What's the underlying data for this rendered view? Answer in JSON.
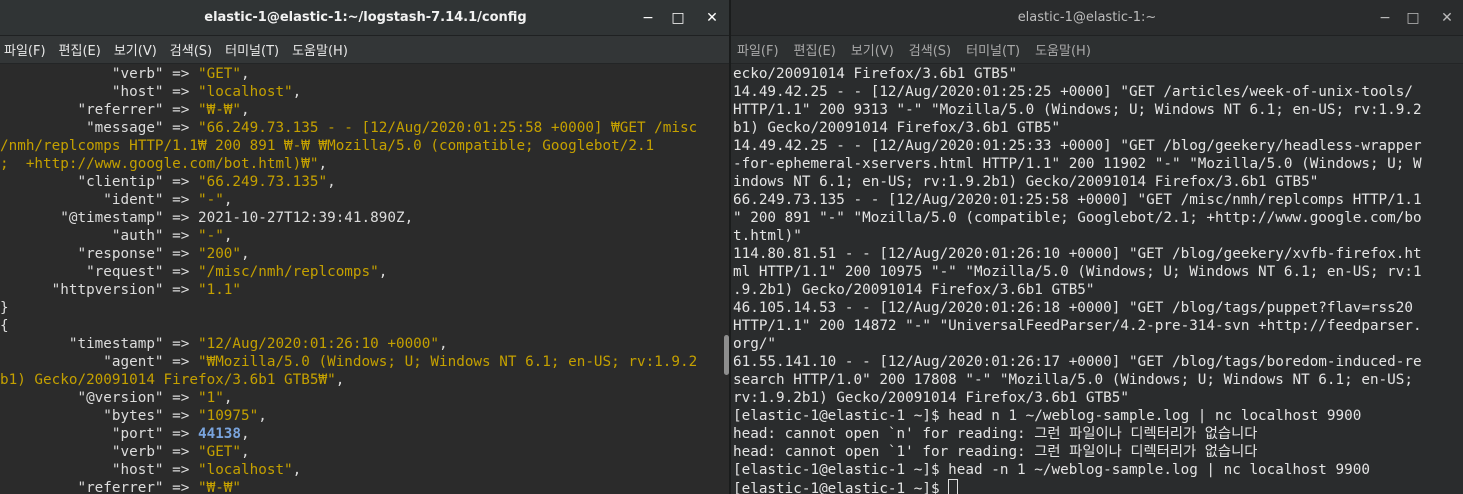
{
  "left_window": {
    "title": "elastic-1@elastic-1:~/logstash-7.14.1/config",
    "minimize": "−",
    "maximize": "□",
    "close": "✕",
    "menu": [
      "파일(F)",
      "편집(E)",
      "보기(V)",
      "검색(S)",
      "터미널(T)",
      "도움말(H)"
    ],
    "lines": [
      {
        "k": "             \"verb\" => ",
        "v": "\"GET\"",
        "t": ","
      },
      {
        "k": "             \"host\" => ",
        "v": "\"localhost\"",
        "t": ","
      },
      {
        "k": "         \"referrer\" => ",
        "v": "\"₩-₩\"",
        "t": ","
      },
      {
        "k": "          \"message\" => ",
        "v": "\"66.249.73.135 - - [12/Aug/2020:01:25:58 +0000] ₩GET /misc",
        "t": ""
      },
      {
        "k": "",
        "v": "/nmh/replcomps HTTP/1.1₩ 200 891 ₩-₩ ₩Mozilla/5.0 (compatible; Googlebot/2.1",
        "t": ""
      },
      {
        "k": "",
        "v": ";  +http://www.google.com/bot.html)₩\"",
        "t": ","
      },
      {
        "k": "         \"clientip\" => ",
        "v": "\"66.249.73.135\"",
        "t": ","
      },
      {
        "k": "            \"ident\" => ",
        "v": "\"-\"",
        "t": ","
      },
      {
        "k": "       \"@timestamp\" => ",
        "v": "",
        "t": "2021-10-27T12:39:41.890Z,"
      },
      {
        "k": "             \"auth\" => ",
        "v": "\"-\"",
        "t": ","
      },
      {
        "k": "         \"response\" => ",
        "v": "\"200\"",
        "t": ","
      },
      {
        "k": "          \"request\" => ",
        "v": "\"/misc/nmh/replcomps\"",
        "t": ","
      },
      {
        "k": "      \"httpversion\" => ",
        "v": "\"1.1\"",
        "t": ""
      },
      {
        "k": "}",
        "v": "",
        "t": ""
      },
      {
        "k": "{",
        "v": "",
        "t": ""
      },
      {
        "k": "        \"timestamp\" => ",
        "v": "\"12/Aug/2020:01:26:10 +0000\"",
        "t": ","
      },
      {
        "k": "            \"agent\" => ",
        "v": "\"₩Mozilla/5.0 (Windows; U; Windows NT 6.1; en-US; rv:1.9.2",
        "t": ""
      },
      {
        "k": "",
        "v": "b1) Gecko/20091014 Firefox/3.6b1 GTB5₩\"",
        "t": ","
      },
      {
        "k": "         \"@version\" => ",
        "v": "\"1\"",
        "t": ","
      },
      {
        "k": "            \"bytes\" => ",
        "v": "\"10975\"",
        "t": ","
      },
      {
        "k": "             \"port\" => ",
        "v": "",
        "t": "",
        "n": "44138",
        "after": ","
      },
      {
        "k": "             \"verb\" => ",
        "v": "\"GET\"",
        "t": ","
      },
      {
        "k": "             \"host\" => ",
        "v": "\"localhost\"",
        "t": ","
      },
      {
        "k": "         \"referrer\" => ",
        "v": "\"₩-₩\"",
        "t": ""
      }
    ]
  },
  "right_window": {
    "title": "elastic-1@elastic-1:~",
    "minimize": "−",
    "maximize": "□",
    "close": "✕",
    "menu": [
      "파일(F)",
      "편집(E)",
      "보기(V)",
      "검색(S)",
      "터미널(T)",
      "도움말(H)"
    ],
    "lines": [
      "ecko/20091014 Firefox/3.6b1 GTB5\"",
      "14.49.42.25 - - [12/Aug/2020:01:25:25 +0000] \"GET /articles/week-of-unix-tools/",
      "HTTP/1.1\" 200 9313 \"-\" \"Mozilla/5.0 (Windows; U; Windows NT 6.1; en-US; rv:1.9.2",
      "b1) Gecko/20091014 Firefox/3.6b1 GTB5\"",
      "14.49.42.25 - - [12/Aug/2020:01:25:33 +0000] \"GET /blog/geekery/headless-wrapper",
      "-for-ephemeral-xservers.html HTTP/1.1\" 200 11902 \"-\" \"Mozilla/5.0 (Windows; U; W",
      "indows NT 6.1; en-US; rv:1.9.2b1) Gecko/20091014 Firefox/3.6b1 GTB5\"",
      "66.249.73.135 - - [12/Aug/2020:01:25:58 +0000] \"GET /misc/nmh/replcomps HTTP/1.1",
      "\" 200 891 \"-\" \"Mozilla/5.0 (compatible; Googlebot/2.1; +http://www.google.com/bo",
      "t.html)\"",
      "114.80.81.51 - - [12/Aug/2020:01:26:10 +0000] \"GET /blog/geekery/xvfb-firefox.ht",
      "ml HTTP/1.1\" 200 10975 \"-\" \"Mozilla/5.0 (Windows; U; Windows NT 6.1; en-US; rv:1",
      ".9.2b1) Gecko/20091014 Firefox/3.6b1 GTB5\"",
      "46.105.14.53 - - [12/Aug/2020:01:26:18 +0000] \"GET /blog/tags/puppet?flav=rss20",
      "HTTP/1.1\" 200 14872 \"-\" \"UniversalFeedParser/4.2-pre-314-svn +http://feedparser.",
      "org/\"",
      "61.55.141.10 - - [12/Aug/2020:01:26:17 +0000] \"GET /blog/tags/boredom-induced-re",
      "search HTTP/1.0\" 200 17808 \"-\" \"Mozilla/5.0 (Windows; U; Windows NT 6.1; en-US;",
      "rv:1.9.2b1) Gecko/20091014 Firefox/3.6b1 GTB5\"",
      "[elastic-1@elastic-1 ~]$ head n 1 ~/weblog-sample.log | nc localhost 9900",
      "head: cannot open `n' for reading: 그런 파일이나 디렉터리가 없습니다",
      "head: cannot open `1' for reading: 그런 파일이나 디렉터리가 없습니다",
      "[elastic-1@elastic-1 ~]$ head -n 1 ~/weblog-sample.log | nc localhost 9900"
    ],
    "prompt": "[elastic-1@elastic-1 ~]$ "
  }
}
